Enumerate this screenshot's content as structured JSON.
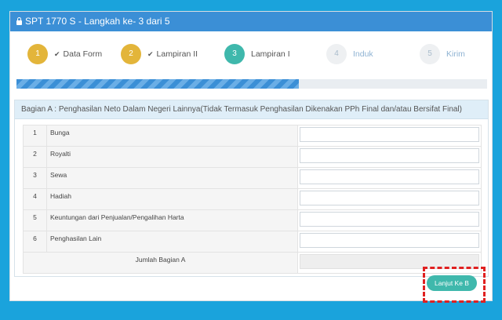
{
  "window": {
    "title": "SPT 1770 S - Langkah ke- 3 dari 5"
  },
  "steps": [
    {
      "number": "1",
      "label": "Data Form",
      "check": "✔",
      "state": "done"
    },
    {
      "number": "2",
      "label": "Lampiran II",
      "check": "✔",
      "state": "done"
    },
    {
      "number": "3",
      "label": "Lampiran I",
      "state": "active"
    },
    {
      "number": "4",
      "label": "Induk",
      "state": "pending"
    },
    {
      "number": "5",
      "label": "Kirim",
      "state": "pending"
    }
  ],
  "progress": {
    "fraction": 0.6
  },
  "section": {
    "title": "Bagian A : Penghasilan Neto Dalam Negeri Lainnya(Tidak Termasuk Penghasilan Dikenakan PPh Final dan/atau Bersifat Final)",
    "rows": [
      {
        "no": "1",
        "label": "Bunga",
        "value": ""
      },
      {
        "no": "2",
        "label": "Royalti",
        "value": ""
      },
      {
        "no": "3",
        "label": "Sewa",
        "value": ""
      },
      {
        "no": "4",
        "label": "Hadiah",
        "value": ""
      },
      {
        "no": "5",
        "label": "Keuntungan dari Penjualan/Pengalihan Harta",
        "value": ""
      },
      {
        "no": "6",
        "label": "Penghasilan Lain",
        "value": ""
      }
    ],
    "total_label": "Jumlah Bagian A",
    "total_value": ""
  },
  "next_button": {
    "label": "Lanjut Ke B"
  },
  "colors": {
    "background": "#1aa3dc",
    "titlebar": "#3b8fd6",
    "done": "#e3b53a",
    "active": "#3fb8ac",
    "highlight": "#e02020"
  }
}
